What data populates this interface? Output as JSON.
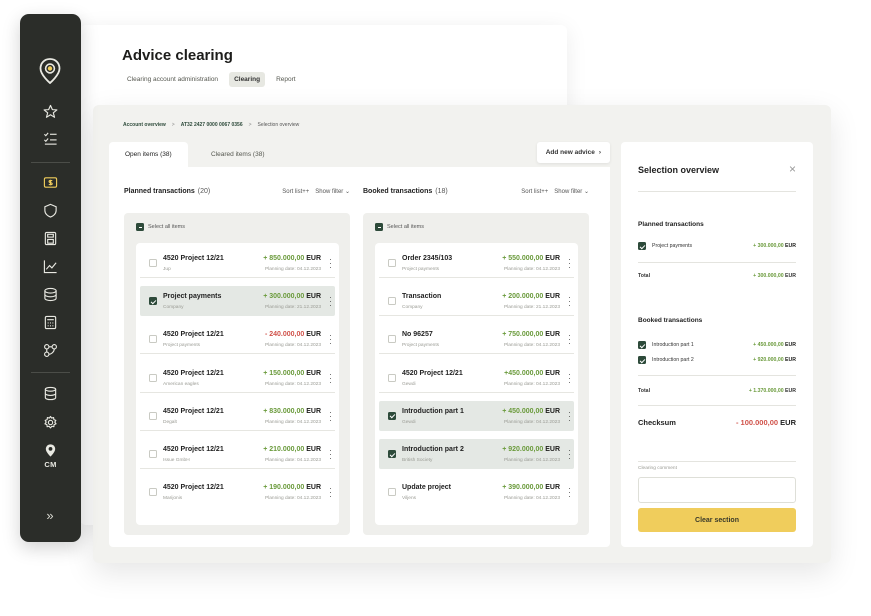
{
  "app": {
    "title": "Advice clearing",
    "brand": "CM",
    "colors": {
      "sidebar": "#2b2d29",
      "accent": "#2d4a3a",
      "positive": "#6a9a3b",
      "negative": "#d0524a",
      "button": "#f0cd5c"
    }
  },
  "sidebar": {
    "icons": [
      "star-icon",
      "checklist-icon",
      "currency-exchange-icon",
      "shield-icon",
      "save-document-icon",
      "line-chart-icon",
      "database-stack-icon",
      "calculator-icon",
      "flow-icon",
      "storage-icon",
      "settings-icon",
      "location-pin-icon"
    ],
    "brand": "CM",
    "expand": "»"
  },
  "top_tabs": [
    {
      "label": "Clearing account administration",
      "active": false
    },
    {
      "label": "Clearing",
      "active": true
    },
    {
      "label": "Report",
      "active": false
    }
  ],
  "breadcrumb": {
    "items": [
      "Account overview",
      "AT32 2427 0000 0067 0356",
      "Selection overview"
    ],
    "sep": ">"
  },
  "tabs": [
    {
      "label": "Open items",
      "count": "(38)",
      "active": true
    },
    {
      "label": "Cleared items",
      "count": "(38)",
      "active": false
    }
  ],
  "add_advice": {
    "label": "Add new advice",
    "chevron": "›"
  },
  "planned": {
    "title": "Planned transactions",
    "count": "(20)",
    "sort": "Sort list++",
    "filter": "Show filter ⌄",
    "select_all": "Select all items",
    "rows": [
      {
        "name": "4520 Project 12/21",
        "sub": "Jup",
        "amount": "+ 850.000,00",
        "currency": "EUR",
        "date": "Planning date: 04.12.2023",
        "checked": false,
        "neg": false
      },
      {
        "name": "Project payments",
        "sub": "Company",
        "amount": "+ 300.000,00",
        "currency": "EUR",
        "date": "Planning date: 21.12.2023",
        "checked": true,
        "neg": false
      },
      {
        "name": "4520 Project 12/21",
        "sub": "Project payments",
        "amount": "- 240.000,00",
        "currency": "EUR",
        "date": "Planning date: 04.12.2023",
        "checked": false,
        "neg": true
      },
      {
        "name": "4520 Project 12/21",
        "sub": "American eagles",
        "amount": "+ 150.000,00",
        "currency": "EUR",
        "date": "Planning date: 04.12.2023",
        "checked": false,
        "neg": false
      },
      {
        "name": "4520 Project 12/21",
        "sub": "Degalt",
        "amount": "+ 830.000,00",
        "currency": "EUR",
        "date": "Planning date: 04.12.2023",
        "checked": false,
        "neg": false
      },
      {
        "name": "4520 Project 12/21",
        "sub": "Issue GmbH",
        "amount": "+ 210.000,00",
        "currency": "EUR",
        "date": "Planning date: 04.12.2023",
        "checked": false,
        "neg": false
      },
      {
        "name": "4520 Project 12/21",
        "sub": "Marijonis",
        "amount": "+ 190.000,00",
        "currency": "EUR",
        "date": "Planning date: 04.12.2023",
        "checked": false,
        "neg": false
      }
    ]
  },
  "booked": {
    "title": "Booked transactions",
    "count": "(18)",
    "sort": "Sort list++",
    "filter": "Show filter ⌄",
    "select_all": "Select all items",
    "rows": [
      {
        "name": "Order 2345/103",
        "sub": "Project payments",
        "amount": "+ 550.000,00",
        "currency": "EUR",
        "date": "Planning date: 04.12.2023",
        "checked": false,
        "neg": false
      },
      {
        "name": "Transaction",
        "sub": "Company",
        "amount": "+ 200.000,00",
        "currency": "EUR",
        "date": "Planning date: 21.12.2023",
        "checked": false,
        "neg": false
      },
      {
        "name": "No 96257",
        "sub": "Project payments",
        "amount": "+ 750.000,00",
        "currency": "EUR",
        "date": "Planning date: 04.12.2023",
        "checked": false,
        "neg": false
      },
      {
        "name": "4520 Project 12/21",
        "sub": "Gewdi",
        "amount": "+450.000,00",
        "currency": "EUR",
        "date": "Planning date: 04.12.2023",
        "checked": false,
        "neg": false
      },
      {
        "name": "Introduction part 1",
        "sub": "Gewdi",
        "amount": "+ 450.000,00",
        "currency": "EUR",
        "date": "Planning date: 04.12.2023",
        "checked": true,
        "neg": false
      },
      {
        "name": "Introduction part 2",
        "sub": "British Society",
        "amount": "+ 920.000,00",
        "currency": "EUR",
        "date": "Planning date: 04.12.2023",
        "checked": true,
        "neg": false
      },
      {
        "name": "Update project",
        "sub": "Viljens",
        "amount": "+ 390.000,00",
        "currency": "EUR",
        "date": "Planning date: 04.12.2023",
        "checked": false,
        "neg": false
      }
    ]
  },
  "overview": {
    "title": "Selection overview",
    "close": "×",
    "planned_title": "Planned transactions",
    "planned_rows": [
      {
        "label": "Project payments",
        "amount": "+ 300.000,00",
        "currency": "EUR"
      }
    ],
    "planned_total_label": "Total",
    "planned_total": "+ 300.000,00",
    "planned_total_currency": "EUR",
    "booked_title": "Booked transactions",
    "booked_rows": [
      {
        "label": "Introduction part 1",
        "amount": "+ 450.000,00",
        "currency": "EUR"
      },
      {
        "label": "Introduction part 2",
        "amount": "+ 920.000,00",
        "currency": "EUR"
      }
    ],
    "booked_total_label": "Total",
    "booked_total": "+ 1.370.000,00",
    "booked_total_currency": "EUR",
    "checksum_label": "Checksum",
    "checksum": "- 100.000,00",
    "checksum_currency": "EUR",
    "comment_label": "Clearing comment",
    "button": "Clear section"
  }
}
